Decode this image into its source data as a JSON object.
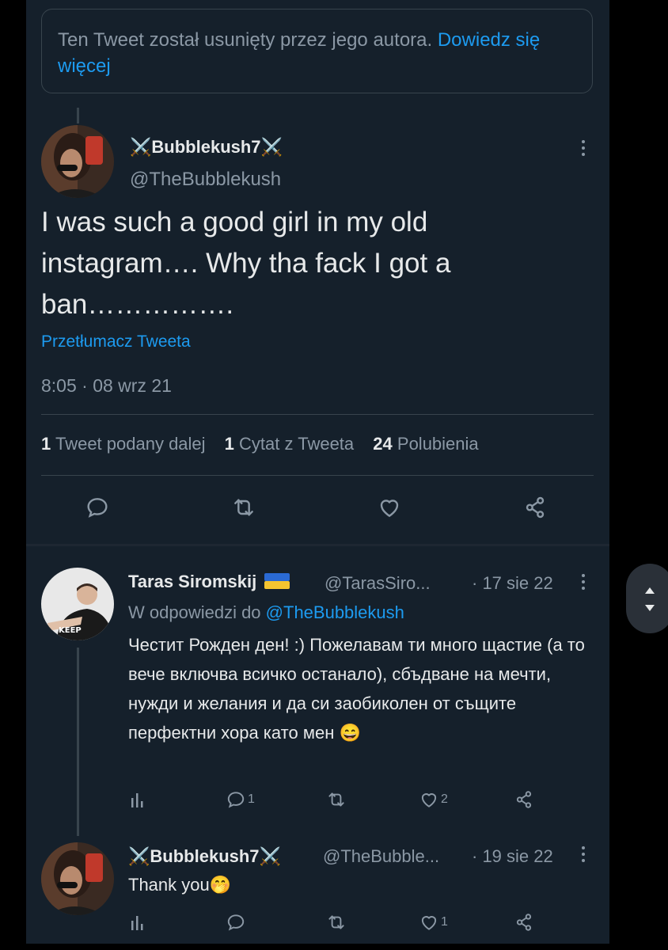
{
  "deleted_notice": {
    "text": "Ten Tweet został usunięty przez jego autora.",
    "link": "Dowiedz się więcej"
  },
  "main_tweet": {
    "name": "Bubblekush7",
    "handle": "@TheBubblekush",
    "text": "I was such a good girl in my old instagram…. Why tha fack I got a ban…………….",
    "translate": "Przetłumacz Tweeta",
    "timestamp": "8:05 · 08 wrz 21",
    "stats": {
      "retweets_count": "1",
      "retweets_label": "Tweet podany dalej",
      "quotes_count": "1",
      "quotes_label": "Cytat z Tweeta",
      "likes_count": "24",
      "likes_label": "Polubienia"
    }
  },
  "replies": [
    {
      "name": "Taras Siromskij",
      "handle": "@TarasSiro...",
      "time": "· 17 sie 22",
      "reply_to_prefix": "W odpowiedzi do",
      "reply_to_handle": "@TheBubblekush",
      "text": "Честит Рожден ден! :) Пожелавам ти много щастие (а то вече включва всичко останало), сбъдване на мечти, нужди и желания и да си заобиколен от същите перфектни хора като мен",
      "emoji": "😄",
      "reply_count": "1",
      "like_count": "2"
    },
    {
      "name": "Bubblekush7",
      "handle": "@TheBubble...",
      "time": "· 19 sie 22",
      "text": "Thank you",
      "emoji": "🤭",
      "reply_count": "",
      "like_count": "1"
    }
  ],
  "colors": {
    "background": "#15202b",
    "text": "#e7e9ea",
    "muted": "#8b98a5",
    "accent": "#1d9bf0",
    "border": "#38444d"
  }
}
